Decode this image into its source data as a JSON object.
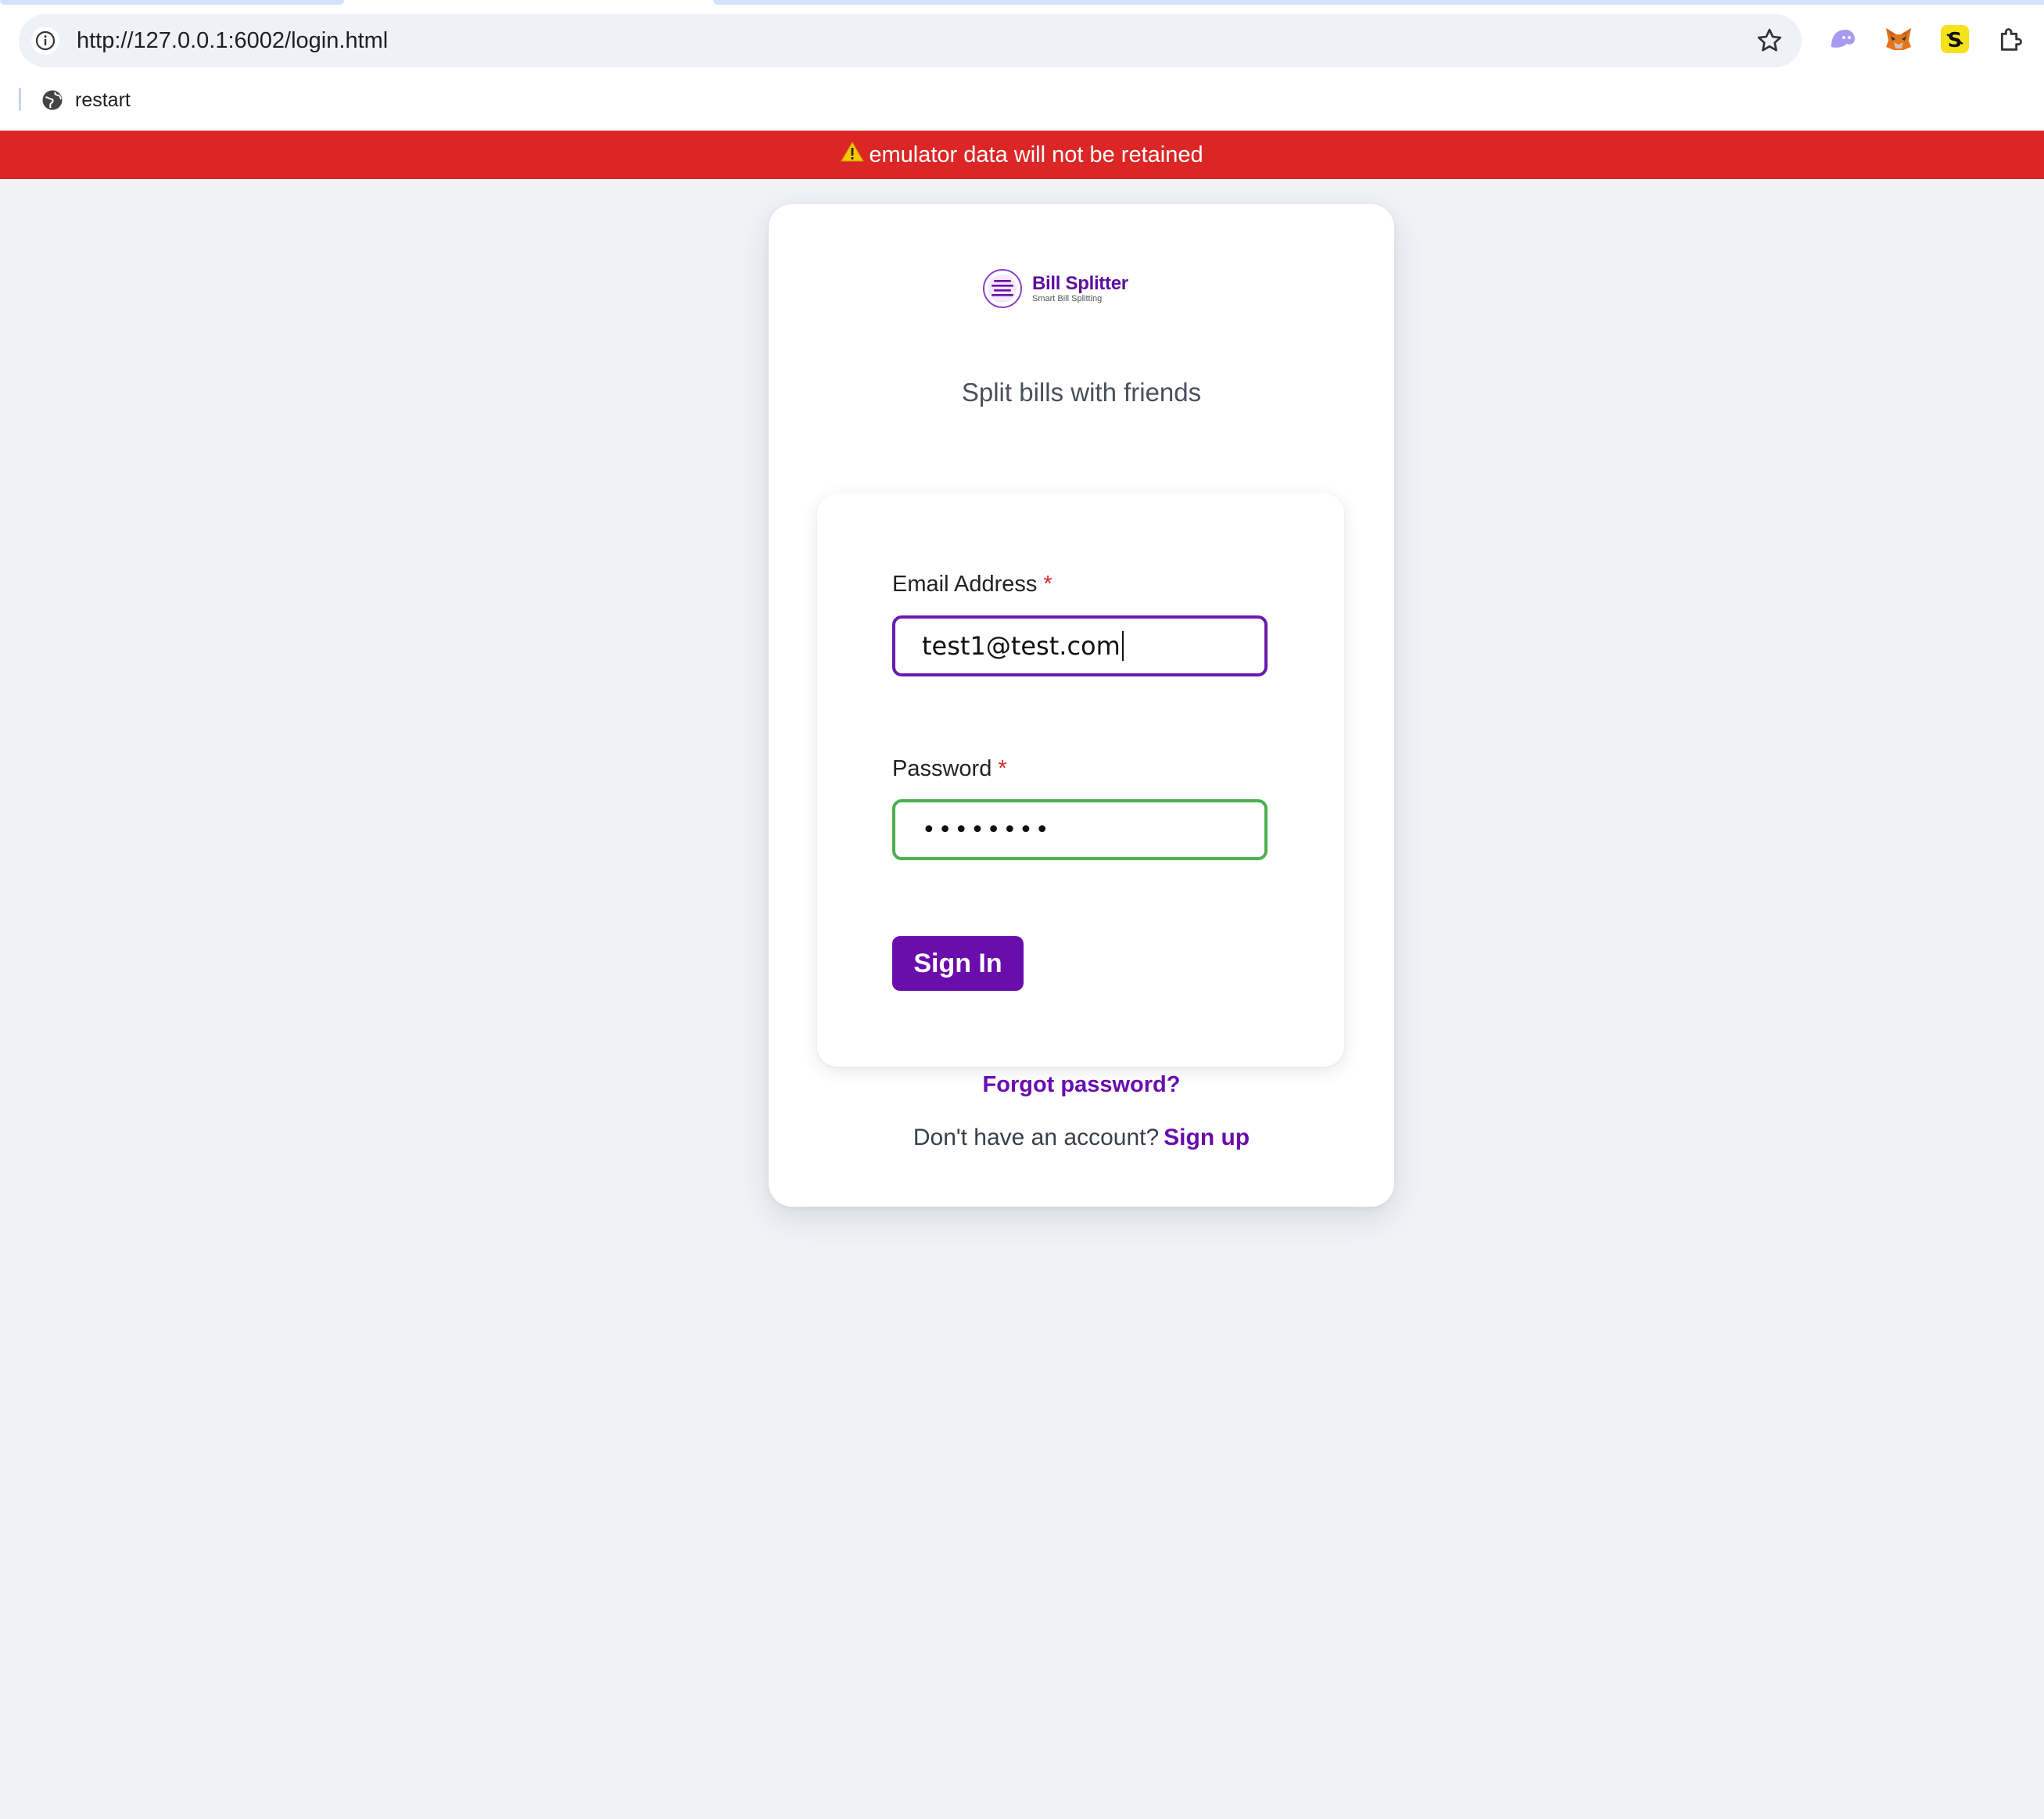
{
  "browser": {
    "url": "http://127.0.0.1:6002/login.html",
    "bookmark_label": "restart",
    "extensions": [
      "ghost-extension-icon",
      "metamask-fox-icon",
      "splitter-extension-icon",
      "puzzle-extensions-icon"
    ]
  },
  "banner": {
    "text": "emulator data will not be retained",
    "icon": "warning-icon",
    "color": "#dc2626"
  },
  "brand": {
    "name": "Bill Splitter",
    "tagline": "Smart Bill Splitting",
    "color": "#5b0fa0"
  },
  "page": {
    "tagline": "Split bills with friends"
  },
  "form": {
    "email_label": "Email Address",
    "email_value": "test1@test.com",
    "required_marker": "*",
    "password_label": "Password",
    "password_value": "••••••••",
    "signin_label": "Sign In",
    "forgot_label": "Forgot password?",
    "no_account_text": "Don't have an account?",
    "signup_label": "Sign up"
  },
  "colors": {
    "accent": "#6a0dad",
    "email_border_focus": "#6a1ab0",
    "password_border_valid": "#4caf50",
    "background": "#f0f2f6"
  }
}
